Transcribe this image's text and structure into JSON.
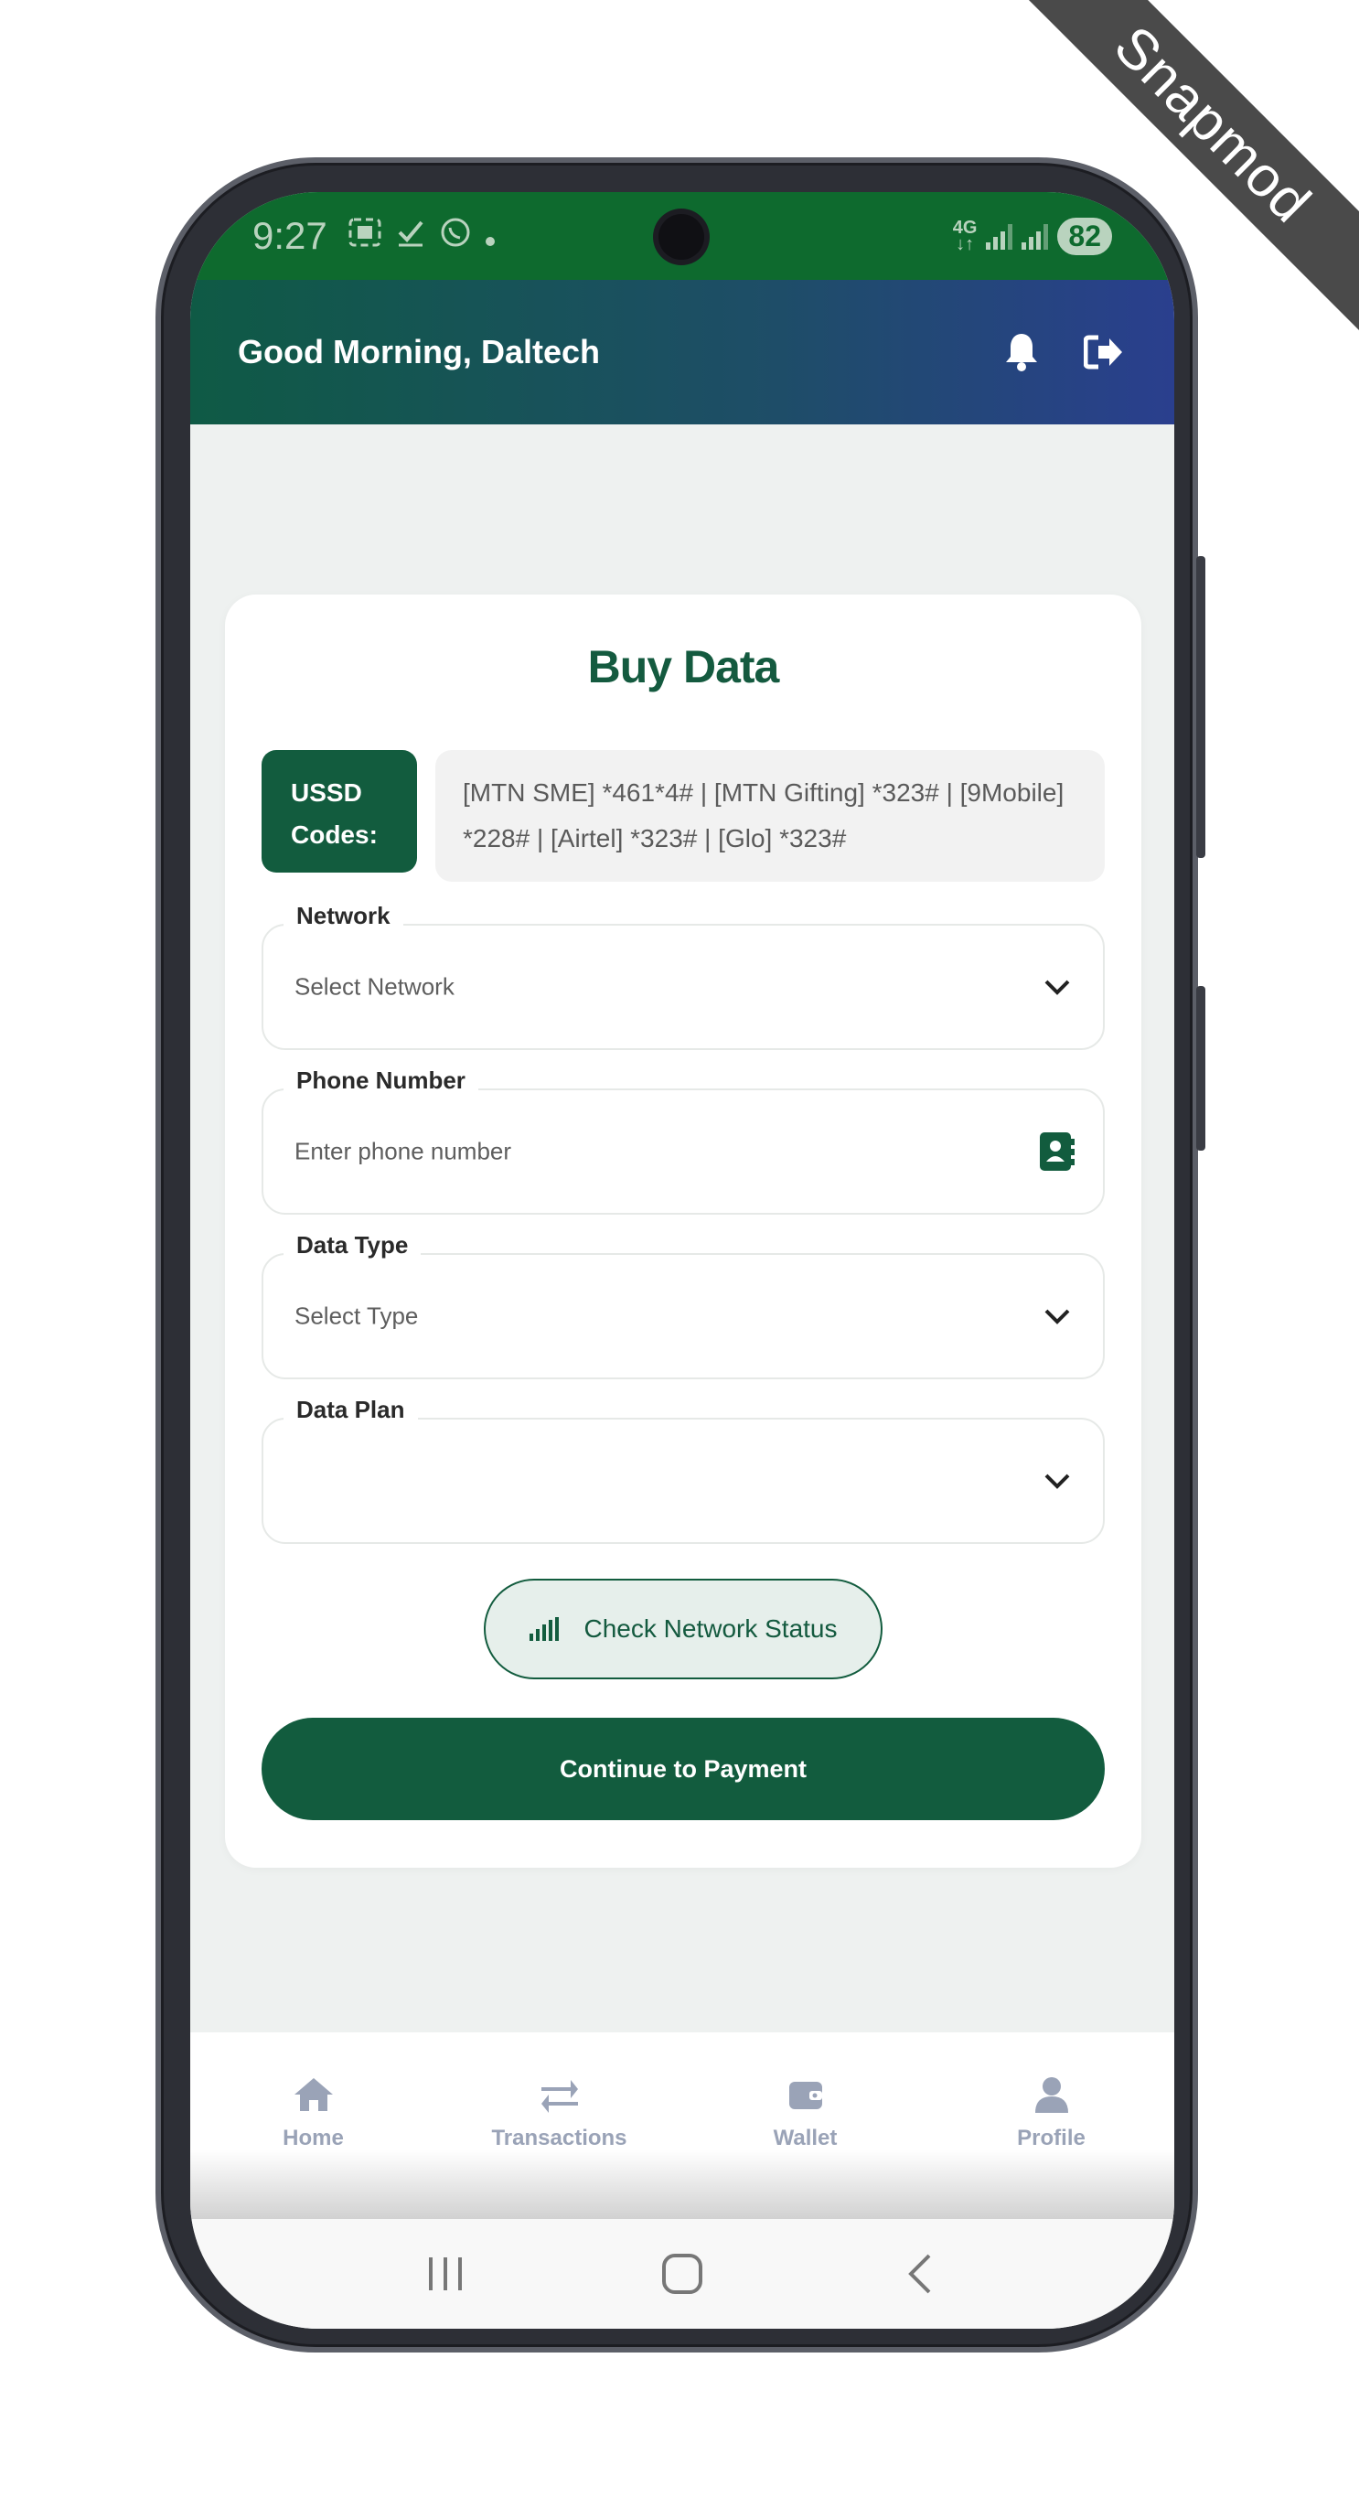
{
  "watermark": "Snapmod",
  "statusbar": {
    "time": "9:27",
    "network_type": "4G",
    "battery": "82",
    "icons": [
      "screenshot-icon",
      "check-icon",
      "whatsapp-icon",
      "dot-icon"
    ]
  },
  "header": {
    "greeting": "Good Morning, Daltech",
    "icons": [
      "bell-icon",
      "logout-icon"
    ]
  },
  "card": {
    "title": "Buy Data",
    "ussd_label": "USSD Codes:",
    "ussd_codes": "[MTN SME] *461*4# | [MTN Gifting] *323# | [9Mobile] *228# | [Airtel] *323# | [Glo] *323#"
  },
  "fields": {
    "network": {
      "label": "Network",
      "value": "Select Network"
    },
    "phone": {
      "label": "Phone Number",
      "placeholder": "Enter phone number"
    },
    "data_type": {
      "label": "Data Type",
      "value": "Select Type"
    },
    "data_plan": {
      "label": "Data Plan",
      "value": ""
    }
  },
  "buttons": {
    "check_status": "Check Network Status",
    "continue": "Continue to Payment"
  },
  "bottom_nav": [
    {
      "label": "Home",
      "icon": "home-icon"
    },
    {
      "label": "Transactions",
      "icon": "transfer-icon"
    },
    {
      "label": "Wallet",
      "icon": "wallet-icon"
    },
    {
      "label": "Profile",
      "icon": "user-icon"
    }
  ],
  "colors": {
    "primary": "#125c3e",
    "statusbar": "#0e6a2e",
    "nav_inactive": "#9aa3b7"
  }
}
